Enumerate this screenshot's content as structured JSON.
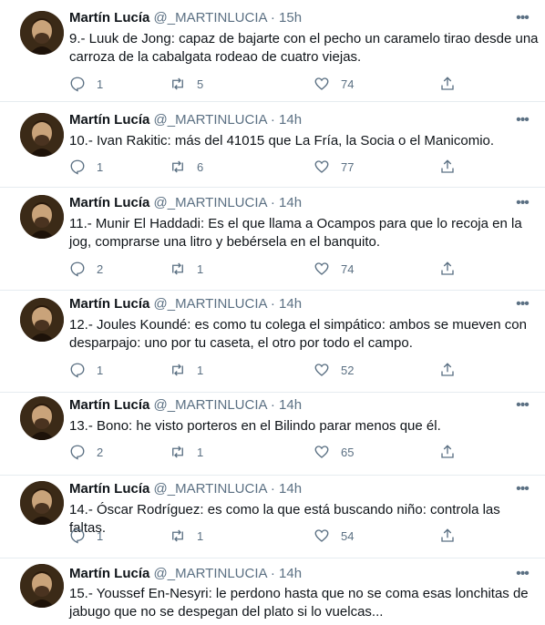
{
  "tweets": [
    {
      "author": "Martín Lucía",
      "handle": "@_MARTINLUCIA",
      "dot": "·",
      "time": "15h",
      "lines": [
        "9.- Luuk de Jong: capaz de bajarte con el pecho un caramelo tirao desde una",
        "carroza de la cabalgata rodeao de cuatro viejas."
      ],
      "replies": "1",
      "retweets": "5",
      "likes": "74"
    },
    {
      "author": "Martín Lucía",
      "handle": "@_MARTINLUCIA",
      "dot": "·",
      "time": "14h",
      "lines": [
        "10.- Ivan Rakitic: más del 41015 que La Fría, la Socia o el Manicomio."
      ],
      "replies": "1",
      "retweets": "6",
      "likes": "77"
    },
    {
      "author": "Martín Lucía",
      "handle": "@_MARTINLUCIA",
      "dot": "·",
      "time": "14h",
      "lines": [
        "11.- Munir El Haddadi: Es el que llama a Ocampos para que lo recoja en la",
        "jog, comprarse una litro y bebérsela en el banquito."
      ],
      "replies": "2",
      "retweets": "1",
      "likes": "74"
    },
    {
      "author": "Martín Lucía",
      "handle": "@_MARTINLUCIA",
      "dot": "·",
      "time": "14h",
      "lines": [
        "12.- Joules Koundé: es como tu colega el simpático: ambos se mueven con",
        "desparpajo: uno por tu caseta, el otro por todo el campo."
      ],
      "replies": "1",
      "retweets": "1",
      "likes": "52"
    },
    {
      "author": "Martín Lucía",
      "handle": "@_MARTINLUCIA",
      "dot": "·",
      "time": "14h",
      "lines": [
        "13.- Bono: he visto porteros en el Bilindo parar menos que él."
      ],
      "replies": "2",
      "retweets": "1",
      "likes": "65"
    },
    {
      "author": "Martín Lucía",
      "handle": "@_MARTINLUCIA",
      "dot": "·",
      "time": "14h",
      "lines": [
        "14.- Óscar Rodríguez: es como la que está buscando niño: controla las faltas."
      ],
      "replies": "1",
      "retweets": "1",
      "likes": "54"
    },
    {
      "author": "Martín Lucía",
      "handle": "@_MARTINLUCIA",
      "dot": "·",
      "time": "14h",
      "lines": [
        "15.- Youssef En-Nesyri: le perdono hasta que no se coma esas lonchitas de",
        "jabugo que no se despegan del plato si lo vuelcas..."
      ],
      "replies": "",
      "retweets": "",
      "likes": ""
    }
  ],
  "icons": {
    "more": "more-horizontal-icon",
    "reply": "reply-icon",
    "retweet": "retweet-icon",
    "like": "heart-icon",
    "share": "share-icon"
  },
  "colors": {
    "text": "#0f1419",
    "muted": "#5b7083",
    "divider": "#e6ecf0"
  }
}
